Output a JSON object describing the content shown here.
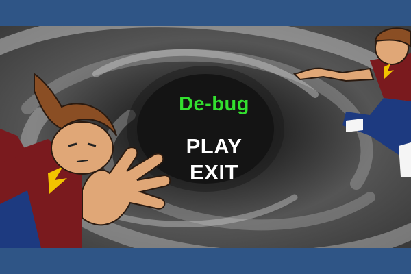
{
  "game": {
    "title": "De-bug",
    "menu": {
      "play_label": "PLAY",
      "exit_label": "EXIT"
    }
  },
  "colors": {
    "frame_blue": "#2f5586",
    "title_green": "#33e02f",
    "menu_white": "#ffffff",
    "vortex_dark": "#1a1a1a",
    "vortex_light": "#bdbdbd"
  }
}
